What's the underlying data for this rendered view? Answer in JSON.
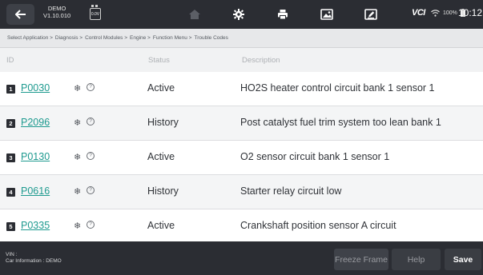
{
  "toolbar": {
    "back_icon": "back-arrow-icon",
    "version_line1": "DEMO",
    "version_line2": "V1.10.010",
    "battery_voltage": "0.0V",
    "icons": [
      "home-icon",
      "settings-gear-icon",
      "printer-icon",
      "image-icon",
      "edit-icon"
    ],
    "vci_label": "VCI",
    "battery_percent": "100%",
    "time": "10:12"
  },
  "breadcrumb": [
    "Select Application >",
    "Diagnosis >",
    "Control Modules >",
    "Engine >",
    "Function Menu >",
    "Trouble Codes"
  ],
  "table": {
    "headers": {
      "id": "ID",
      "status": "Status",
      "description": "Description"
    },
    "rows": [
      {
        "num": "1",
        "code": "P0030",
        "status": "Active",
        "description": "HO2S heater control circuit bank 1  sensor 1"
      },
      {
        "num": "2",
        "code": "P2096",
        "status": "History",
        "description": "Post catalyst fuel trim system too lean bank 1"
      },
      {
        "num": "3",
        "code": "P0130",
        "status": "Active",
        "description": "O2 sensor circuit bank 1 sensor 1"
      },
      {
        "num": "4",
        "code": "P0616",
        "status": "History",
        "description": "Starter relay circuit low"
      },
      {
        "num": "5",
        "code": "P0335",
        "status": "Active",
        "description": "Crankshaft position sensor A circuit"
      }
    ]
  },
  "bottom": {
    "vin_label": "VIN :",
    "car_info": "Car Information : DEMO",
    "freeze_frame": "Freeze Frame",
    "help": "Help",
    "save": "Save"
  },
  "colors": {
    "bar_background": "#2b2d33",
    "code_link": "#1e9a8f",
    "row_alt": "#f4f5f6"
  }
}
